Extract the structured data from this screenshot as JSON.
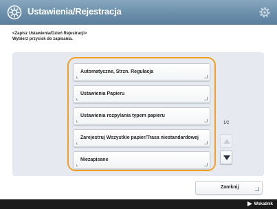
{
  "header": {
    "title": "Ustawienia/Rejestracja",
    "icon": "settings-register-icon",
    "gear_icon": "gear-icon",
    "color": "#6b8fab"
  },
  "breadcrumb": "<Zapisz Ustawienia/Dzień Rejestracji>",
  "instruction": "Wybierz przycisk do zapisania.",
  "list": {
    "items": [
      {
        "label": "Automatyczne, Strzn. Regulacja"
      },
      {
        "label": "Ustawienia Papieru"
      },
      {
        "label": "Ustawienia rozpylania typem papieru"
      },
      {
        "label": "Zarejestruj Wszystkie papier/Trasa niestandardowej"
      },
      {
        "label": "Niezapisane"
      }
    ],
    "frame_color": "#f0a020"
  },
  "pagination": {
    "indicator": "1/2",
    "up_icon": "arrow-up-icon",
    "down_icon": "arrow-down-icon"
  },
  "back_button": {
    "label": "Zamknij"
  },
  "footer": {
    "status_icon": "status-monitor-icon",
    "status_label": "Wskaźnik"
  }
}
